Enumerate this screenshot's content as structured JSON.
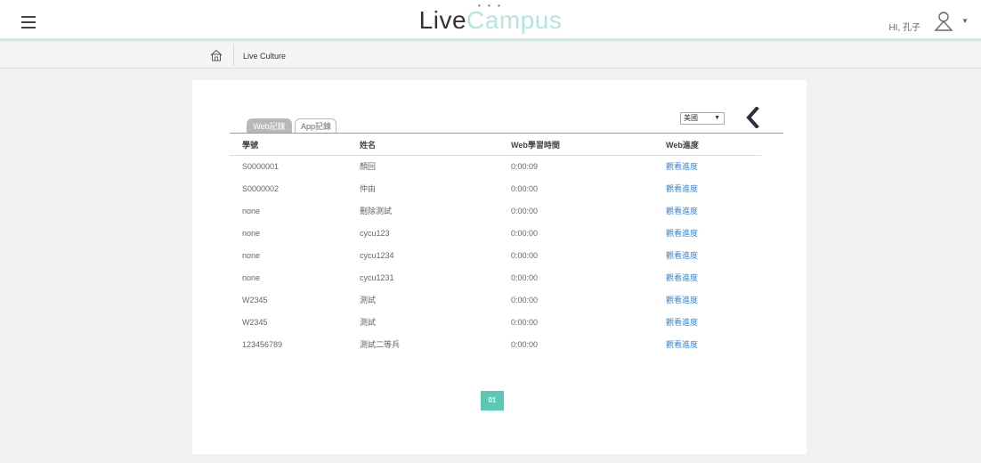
{
  "header": {
    "logo_live": "Live",
    "logo_campus": "Campus",
    "greeting": "HI, 孔子"
  },
  "breadcrumb": {
    "label": "Live Culture"
  },
  "tabs": [
    {
      "label": "Web記錄"
    },
    {
      "label": "App記錄"
    }
  ],
  "filter": {
    "selected": "美國"
  },
  "table": {
    "columns": [
      "學號",
      "姓名",
      "Web學習時間",
      "Web進度"
    ],
    "rows": [
      [
        "S0000001",
        "顏回",
        "0:00:09",
        "觀看進度"
      ],
      [
        "S0000002",
        "仲由",
        "0:00:00",
        "觀看進度"
      ],
      [
        "none",
        "刪除測試",
        "0:00:00",
        "觀看進度"
      ],
      [
        "none",
        "cycu123",
        "0:00:00",
        "觀看進度"
      ],
      [
        "none",
        "cycu1234",
        "0:00:00",
        "觀看進度"
      ],
      [
        "none",
        "cycu1231",
        "0:00:00",
        "觀看進度"
      ],
      [
        "W2345",
        "測試",
        "0:00:00",
        "觀看進度"
      ],
      [
        "W2345",
        "測試",
        "0:00:00",
        "觀看進度"
      ],
      [
        "123456789",
        "測試二等兵",
        "0:00:00",
        "觀看進度"
      ]
    ]
  },
  "pagination": {
    "current": "01"
  },
  "colors": {
    "accent": "#5bc8b6",
    "header_border": "#c8ebe6",
    "link": "#3a8ad6",
    "logo_campus": "#b7e5dd"
  },
  "icons": [
    "menu-icon",
    "user-icon",
    "home-icon",
    "back-chevron-icon"
  ]
}
